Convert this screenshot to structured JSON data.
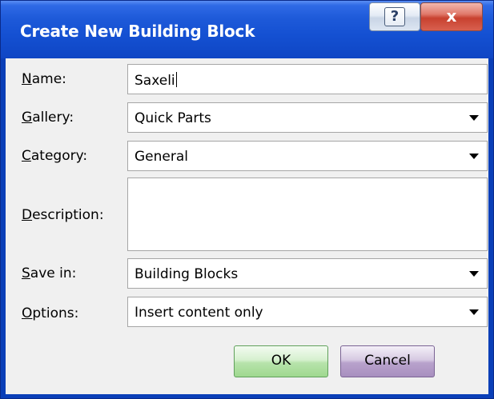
{
  "window": {
    "title": "Create New Building Block",
    "help_glyph": "?",
    "close_glyph": "x"
  },
  "form": {
    "name": {
      "label": "Name:",
      "value": "Saxeli"
    },
    "gallery": {
      "label": "Gallery:",
      "value": "Quick Parts"
    },
    "category": {
      "label": "Category:",
      "value": "General"
    },
    "description": {
      "label": "Description:",
      "value": ""
    },
    "save_in": {
      "label": "Save in:",
      "value": "Building Blocks"
    },
    "options": {
      "label": "Options:",
      "value": "Insert content only"
    }
  },
  "buttons": {
    "ok": "OK",
    "cancel": "Cancel"
  },
  "icons": {
    "help": "help-icon",
    "close": "close-icon",
    "dropdown": "chevron-down-icon"
  },
  "colors": {
    "titlebar": "#1450d2",
    "ok_button": "#b7e3ab",
    "cancel_button": "#b8a2cc",
    "close_button": "#c8412f"
  }
}
